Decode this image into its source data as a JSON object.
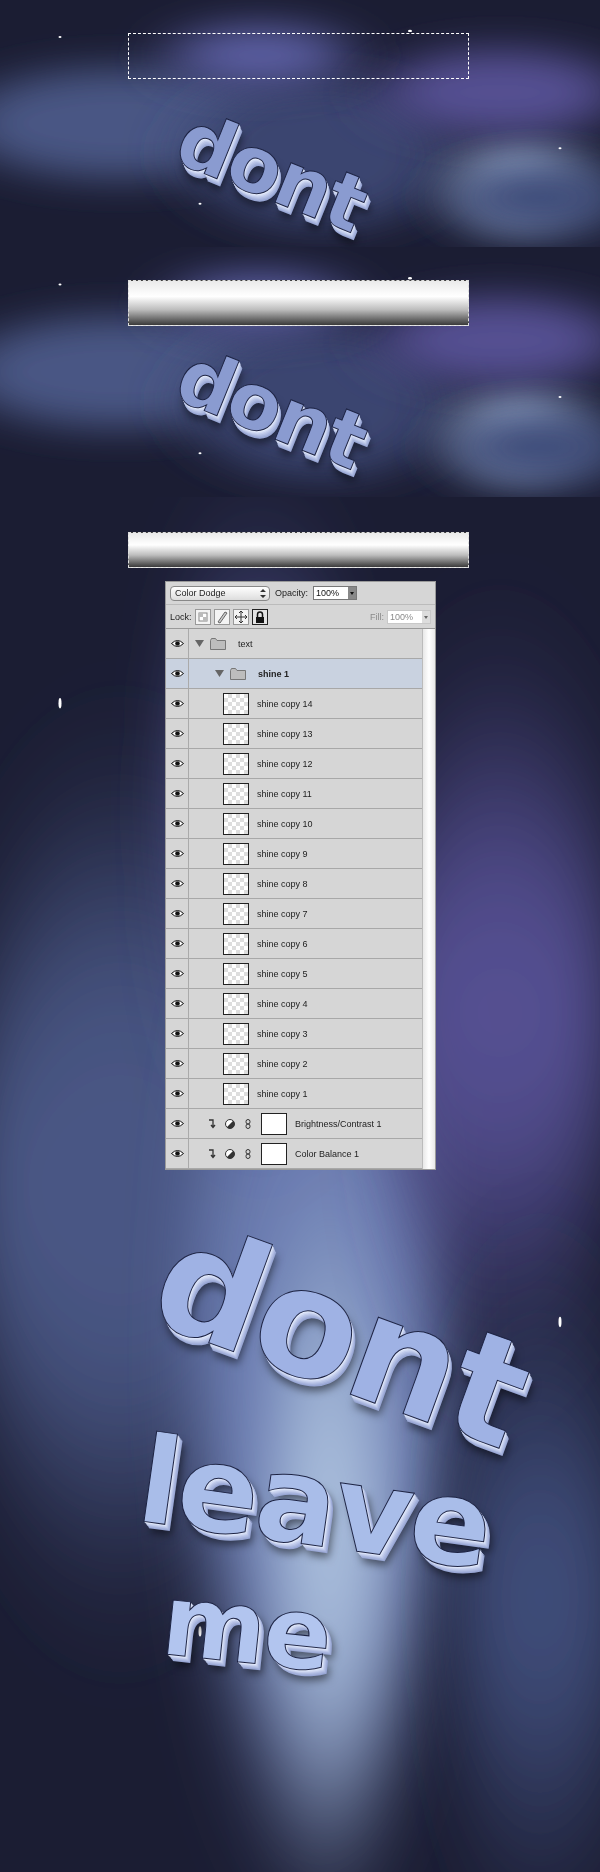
{
  "steps": [
    {
      "selection": {
        "kind": "marquee"
      },
      "artwork": [
        "dont"
      ]
    },
    {
      "selection": {
        "kind": "gradient"
      },
      "artwork": [
        "dont"
      ]
    },
    {
      "selection": {
        "kind": "gradient"
      },
      "layers_panel": {
        "blend_mode": "Color Dodge",
        "opacity_label": "Opacity:",
        "opacity": "100%",
        "lock_label": "Lock:",
        "fill_label": "Fill:",
        "fill": "100%",
        "fill_disabled": true,
        "locks": [
          {
            "kind": "transparency",
            "on": false
          },
          {
            "kind": "pixels",
            "on": false
          },
          {
            "kind": "position",
            "on": false
          },
          {
            "kind": "all",
            "on": true
          }
        ],
        "layers": [
          {
            "kind": "group",
            "name": "text",
            "visible": true,
            "expanded": true,
            "selected": false,
            "children": [
              {
                "kind": "group",
                "name": "shine 1",
                "visible": true,
                "expanded": true,
                "selected": true,
                "children": [
                  {
                    "kind": "layer",
                    "name": "shine copy 14",
                    "visible": true,
                    "selected": false
                  },
                  {
                    "kind": "layer",
                    "name": "shine copy 13",
                    "visible": true,
                    "selected": false
                  },
                  {
                    "kind": "layer",
                    "name": "shine copy 12",
                    "visible": true,
                    "selected": false
                  },
                  {
                    "kind": "layer",
                    "name": "shine copy 11",
                    "visible": true,
                    "selected": false
                  },
                  {
                    "kind": "layer",
                    "name": "shine copy 10",
                    "visible": true,
                    "selected": false
                  },
                  {
                    "kind": "layer",
                    "name": "shine copy 9",
                    "visible": true,
                    "selected": false
                  },
                  {
                    "kind": "layer",
                    "name": "shine copy 8",
                    "visible": true,
                    "selected": false
                  },
                  {
                    "kind": "layer",
                    "name": "shine copy 7",
                    "visible": true,
                    "selected": false
                  },
                  {
                    "kind": "layer",
                    "name": "shine copy 6",
                    "visible": true,
                    "selected": false
                  },
                  {
                    "kind": "layer",
                    "name": "shine copy 5",
                    "visible": true,
                    "selected": false
                  },
                  {
                    "kind": "layer",
                    "name": "shine copy 4",
                    "visible": true,
                    "selected": false
                  },
                  {
                    "kind": "layer",
                    "name": "shine copy 3",
                    "visible": true,
                    "selected": false
                  },
                  {
                    "kind": "layer",
                    "name": "shine copy 2",
                    "visible": true,
                    "selected": false
                  },
                  {
                    "kind": "layer",
                    "name": "shine copy 1",
                    "visible": true,
                    "selected": false
                  }
                ]
              },
              {
                "kind": "adjustment",
                "name": "Brightness/Contrast 1",
                "visible": true,
                "selected": false
              },
              {
                "kind": "adjustment",
                "name": "Color Balance 1",
                "visible": true,
                "selected": false
              }
            ]
          }
        ]
      },
      "artwork": [
        "dont",
        "leave",
        "me"
      ]
    }
  ]
}
